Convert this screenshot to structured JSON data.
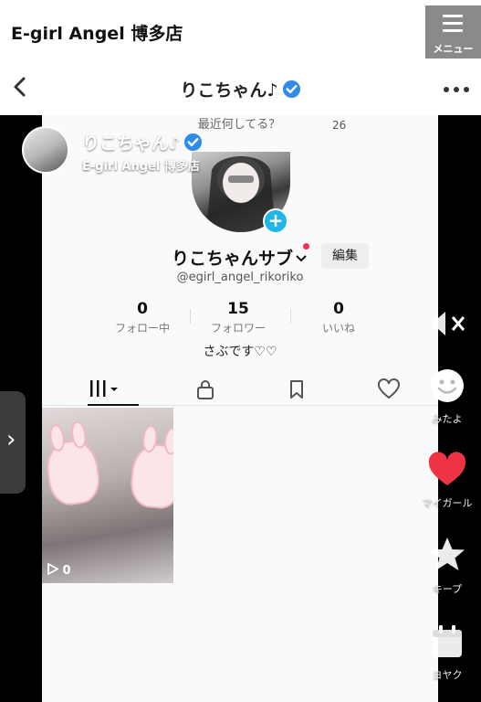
{
  "site": {
    "title": "E-girl Angel 博多店",
    "menu_label": "メニュー"
  },
  "nav": {
    "title": "りこちゃん♪"
  },
  "screen": {
    "ghost_question": "最近何してる？",
    "ghost_count": "26",
    "profile_name": "りこちゃんサブ",
    "edit_label": "編集",
    "handle": "@egirl_angel_rikoriko",
    "stats": [
      {
        "value": "0",
        "label": "フォロー中"
      },
      {
        "value": "15",
        "label": "フォロワー"
      },
      {
        "value": "0",
        "label": "いいね"
      }
    ],
    "bio": "さぶです♡♡",
    "video_views": "0"
  },
  "overlay": {
    "name": "りこちゃん♪",
    "shop": "E-girl Angel 博多店"
  },
  "rail": {
    "mitayo": "みたよ",
    "my_girl": "マイガール",
    "keep": "キープ",
    "reserve": "ヨヤク"
  },
  "colors": {
    "verified": "#2f8ce8",
    "like": "#ee3344",
    "plus": "#20b6e8"
  }
}
